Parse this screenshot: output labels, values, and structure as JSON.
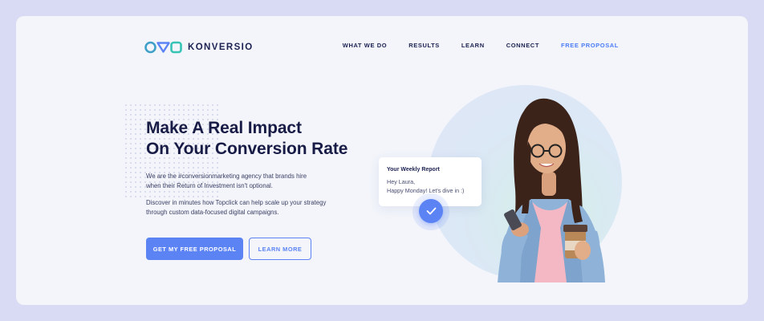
{
  "brand": {
    "name": "KONVERSIO",
    "logo_icon": "konversio-logo-icon",
    "accent_color": "#5b83f4",
    "logo_color": "#3ea0c9"
  },
  "nav": {
    "items": [
      "WHAT WE DO",
      "RESULTS",
      "LEARN",
      "CONNECT"
    ],
    "cta": "FREE PROPOSAL"
  },
  "hero": {
    "headline_line1": "Make A Real Impact",
    "headline_line2": "On Your Conversion Rate",
    "paragraph1": "We are the #conversionmarketing agency that brands hire when their Return of Investment isn't optional.",
    "paragraph2": "Discover in minutes how Topclick can help scale up your strategy through custom data-focused digital campaigns.",
    "primary_button": "GET MY FREE PROPOSAL",
    "secondary_button": "LEARN MORE"
  },
  "report_card": {
    "title": "Your Weekly Report",
    "line1": "Hey Laura,",
    "line2": "Happy Monday!  Let's dive in :)"
  },
  "check_icon": "check-icon"
}
